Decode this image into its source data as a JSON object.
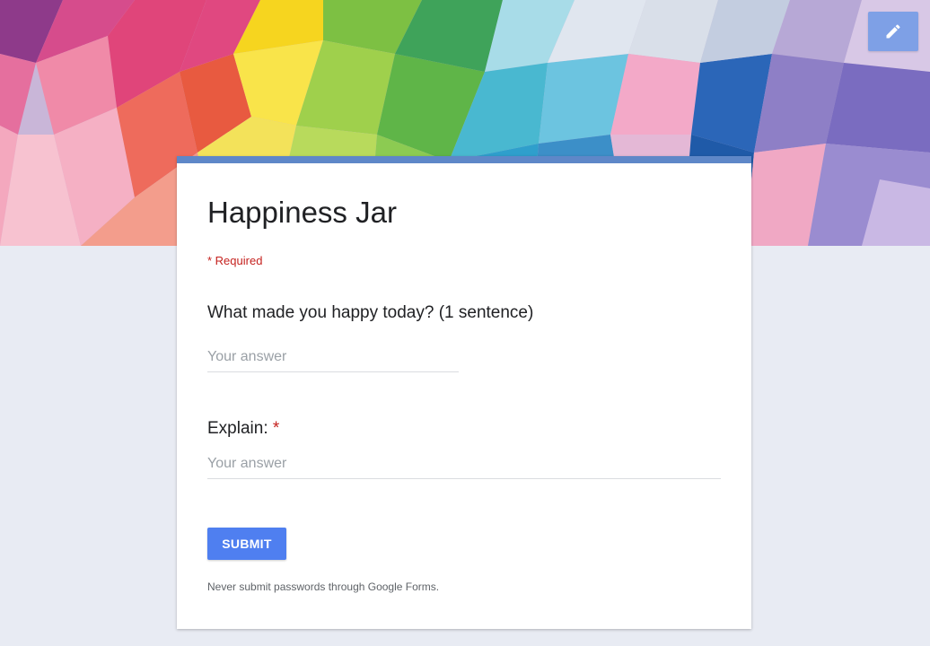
{
  "form": {
    "title": "Happiness Jar",
    "required_note": "* Required",
    "questions": [
      {
        "label": "What made you happy today? (1 sentence)",
        "required": false,
        "placeholder": "Your answer"
      },
      {
        "label": "Explain:",
        "required_mark": "*",
        "required": true,
        "placeholder": "Your answer"
      }
    ],
    "submit_label": "SUBMIT",
    "footer_note": "Never submit passwords through Google Forms."
  },
  "header": {
    "edit_icon": "pencil-icon"
  },
  "colors": {
    "accent": "#5e87c8",
    "submit": "#4f7ff0",
    "required": "#c5221f",
    "background": "#e8ebf3"
  }
}
